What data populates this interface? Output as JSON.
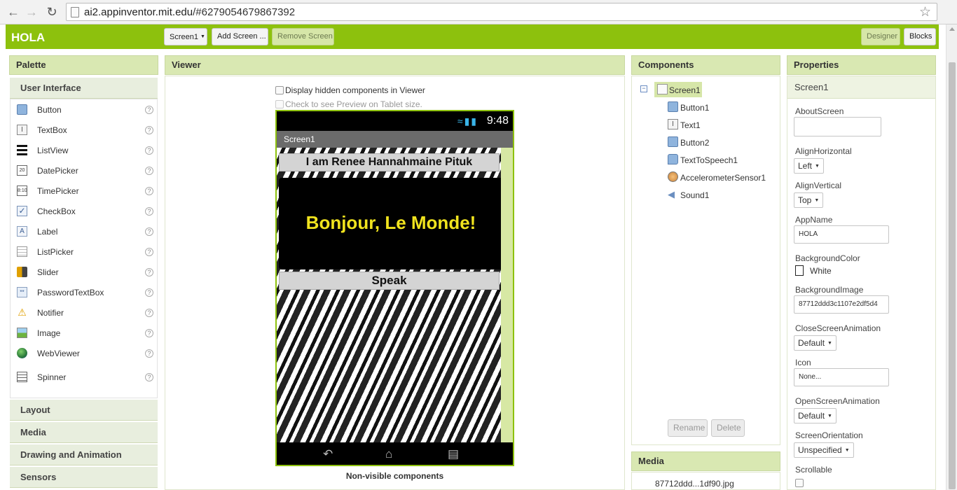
{
  "browser": {
    "url_host": "ai2.appinventor.mit.edu",
    "url_hash": "/#6279054679867392",
    "back_icon": "arrow-left-icon",
    "forward_icon": "arrow-right-icon",
    "reload_icon": "reload-icon",
    "star_icon": "star-icon"
  },
  "app": {
    "title": "HOLA",
    "accent_color": "#8dc10d",
    "toolbar": {
      "screen_select": "Screen1",
      "add_screen": "Add Screen ...",
      "remove_screen": "Remove Screen",
      "designer": "Designer",
      "blocks": "Blocks"
    }
  },
  "palette": {
    "header": "Palette",
    "section_open": "User Interface",
    "items": [
      {
        "label": "Button",
        "icon": "button-icon"
      },
      {
        "label": "TextBox",
        "icon": "textbox-icon"
      },
      {
        "label": "ListView",
        "icon": "listview-icon"
      },
      {
        "label": "DatePicker",
        "icon": "datepicker-icon"
      },
      {
        "label": "TimePicker",
        "icon": "timepicker-icon"
      },
      {
        "label": "CheckBox",
        "icon": "checkbox-icon"
      },
      {
        "label": "Label",
        "icon": "label-icon"
      },
      {
        "label": "ListPicker",
        "icon": "listpicker-icon"
      },
      {
        "label": "Slider",
        "icon": "slider-icon"
      },
      {
        "label": "PasswordTextBox",
        "icon": "password-icon"
      },
      {
        "label": "Notifier",
        "icon": "notifier-icon"
      },
      {
        "label": "Image",
        "icon": "image-icon"
      },
      {
        "label": "WebViewer",
        "icon": "webviewer-icon"
      },
      {
        "label": "Spinner",
        "icon": "spinner-icon"
      }
    ],
    "help_glyph": "?",
    "sections": [
      "Layout",
      "Media",
      "Drawing and Animation",
      "Sensors"
    ]
  },
  "viewer": {
    "header": "Viewer",
    "check_hidden": "Display hidden components in Viewer",
    "check_tablet": "Check to see Preview on Tablet size.",
    "phone": {
      "time": "9:48",
      "screen_title": "Screen1",
      "button1_text": "I am Renee Hannahmaine Pituk",
      "label_text": "Bonjour, Le Monde!",
      "button2_text": "Speak"
    },
    "nonvisible_title": "Non-visible components"
  },
  "components": {
    "header": "Components",
    "root": "Screen1",
    "items": [
      {
        "label": "Button1",
        "icon": "button-icon"
      },
      {
        "label": "Text1",
        "icon": "textbox-icon"
      },
      {
        "label": "Button2",
        "icon": "button-icon"
      },
      {
        "label": "TextToSpeech1",
        "icon": "speech-icon"
      },
      {
        "label": "AccelerometerSensor1",
        "icon": "accelerometer-icon"
      },
      {
        "label": "Sound1",
        "icon": "speaker-icon"
      }
    ],
    "rename": "Rename",
    "delete": "Delete"
  },
  "media": {
    "header": "Media",
    "file": "87712ddd...1df90.jpg"
  },
  "properties": {
    "header": "Properties",
    "component": "Screen1",
    "about_label": "AboutScreen",
    "about_value": "",
    "alignh_label": "AlignHorizontal",
    "alignh_value": "Left",
    "alignv_label": "AlignVertical",
    "alignv_value": "Top",
    "appname_label": "AppName",
    "appname_value": "HOLA",
    "bgcolor_label": "BackgroundColor",
    "bgcolor_value": "White",
    "bgimage_label": "BackgroundImage",
    "bgimage_value": "87712ddd3c1107e2df5d4",
    "closeanim_label": "CloseScreenAnimation",
    "closeanim_value": "Default",
    "icon_label": "Icon",
    "icon_value": "None...",
    "openanim_label": "OpenScreenAnimation",
    "openanim_value": "Default",
    "orientation_label": "ScreenOrientation",
    "orientation_value": "Unspecified",
    "scrollable_label": "Scrollable"
  }
}
